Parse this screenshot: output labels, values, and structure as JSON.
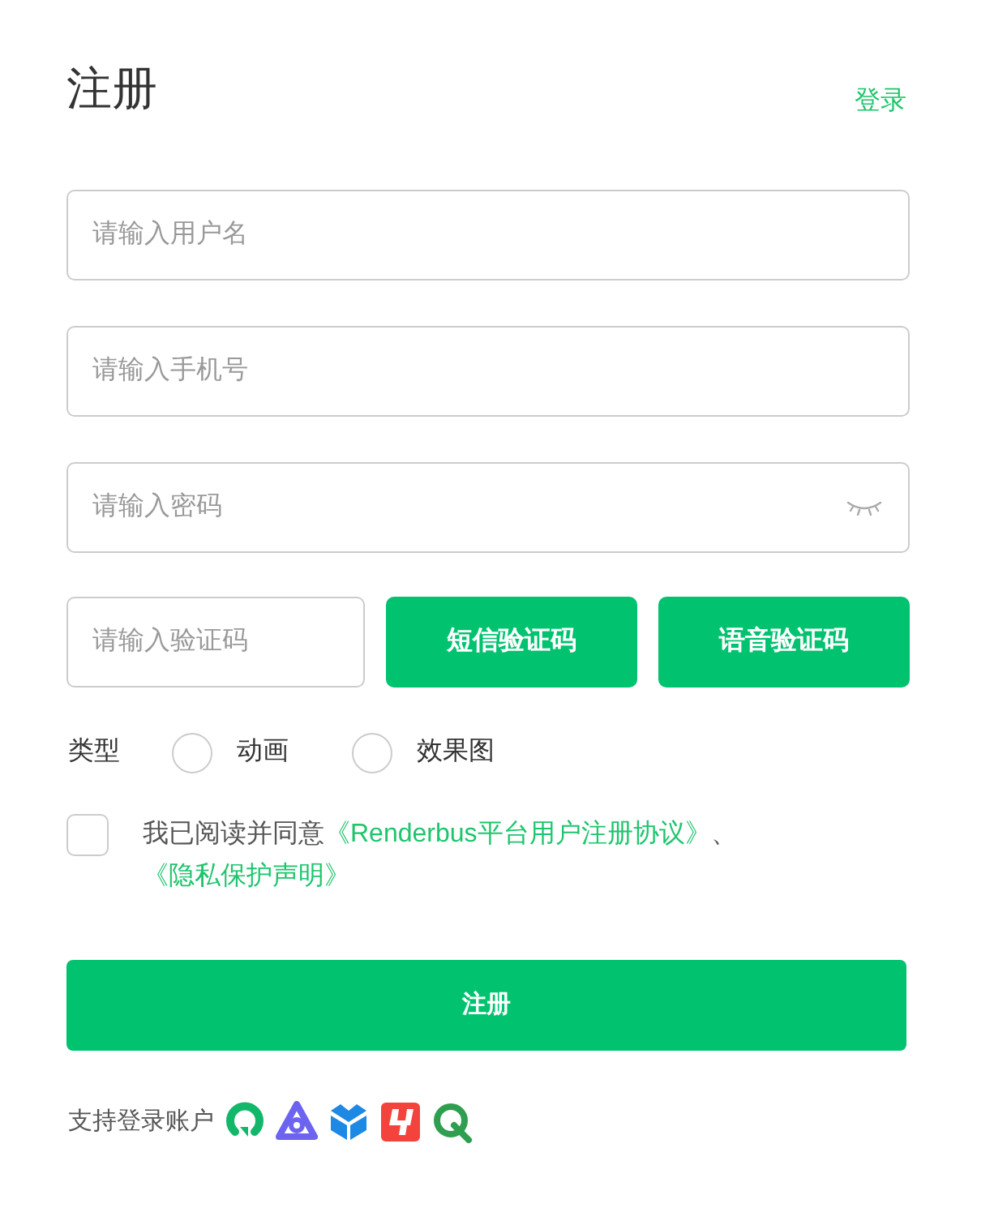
{
  "header": {
    "title": "注册",
    "login_link": "登录"
  },
  "fields": [
    {
      "kind": "text",
      "placeholder": "请输入用户名"
    },
    {
      "kind": "text",
      "placeholder": "请输入手机号"
    },
    {
      "kind": "password",
      "placeholder": "请输入密码"
    }
  ],
  "verification": {
    "placeholder": "请输入验证码",
    "buttons": [
      "短信验证码",
      "语音验证码"
    ]
  },
  "type_choice": {
    "label": "类型",
    "options": [
      {
        "label": "动画",
        "selected": false
      },
      {
        "label": "效果图",
        "selected": false
      }
    ]
  },
  "agreement": {
    "checked": false,
    "parts": [
      {
        "kind": "text",
        "text": "我已阅读并同意"
      },
      {
        "kind": "link",
        "text": "《Renderbus平台用户注册协议》"
      },
      {
        "kind": "text",
        "text": "、"
      },
      {
        "kind": "link",
        "text": "《隐私保护声明》"
      }
    ]
  },
  "submit_button": "注册",
  "footer": {
    "label": "支持登录账户"
  }
}
